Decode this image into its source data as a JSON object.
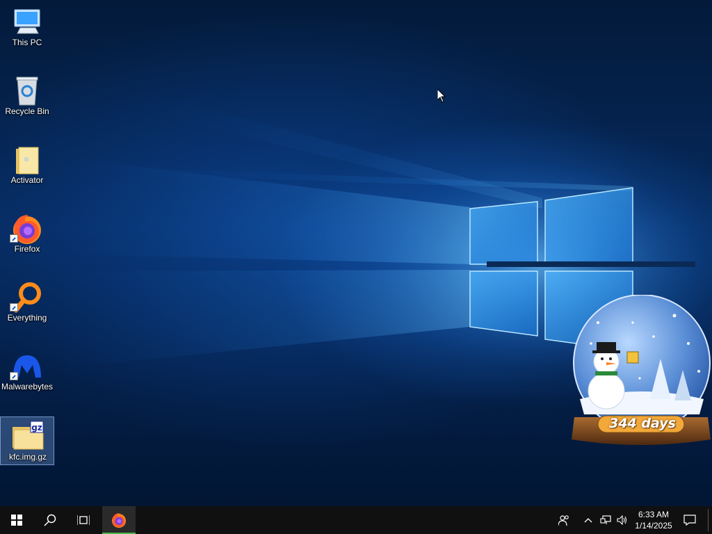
{
  "desktop": {
    "icons": [
      {
        "label": "This PC",
        "icon": "computer-icon"
      },
      {
        "label": "Recycle Bin",
        "icon": "recycle-bin-icon"
      },
      {
        "label": "Activator",
        "icon": "folder-icon"
      },
      {
        "label": "Firefox",
        "icon": "firefox-icon",
        "shortcut": true
      },
      {
        "label": "Everything",
        "icon": "everything-search-icon",
        "shortcut": true
      },
      {
        "label": "Malwarebytes",
        "icon": "malwarebytes-icon",
        "shortcut": true
      },
      {
        "label": "kfc.img.gz",
        "icon": "gz-archive-icon",
        "selected": true
      }
    ]
  },
  "widget": {
    "countdown": "344 days",
    "icon": "snow-globe-icon"
  },
  "taskbar": {
    "start": "windows-start-icon",
    "search": "search-icon",
    "task_view": "task-view-icon",
    "pinned": [
      {
        "app": "Firefox",
        "icon": "firefox-icon",
        "active": true
      }
    ],
    "tray": {
      "icons": [
        "people-icon",
        "chevron-up-icon",
        "network-icon",
        "volume-icon"
      ],
      "time": "6:33 AM",
      "date": "1/14/2025",
      "notifications": "action-center-icon"
    }
  },
  "colors": {
    "wallpaper_base": "#04204a",
    "wallpaper_light": "#3fb0ff",
    "taskbar": "#101010",
    "active_indicator": "#4ab84a"
  }
}
